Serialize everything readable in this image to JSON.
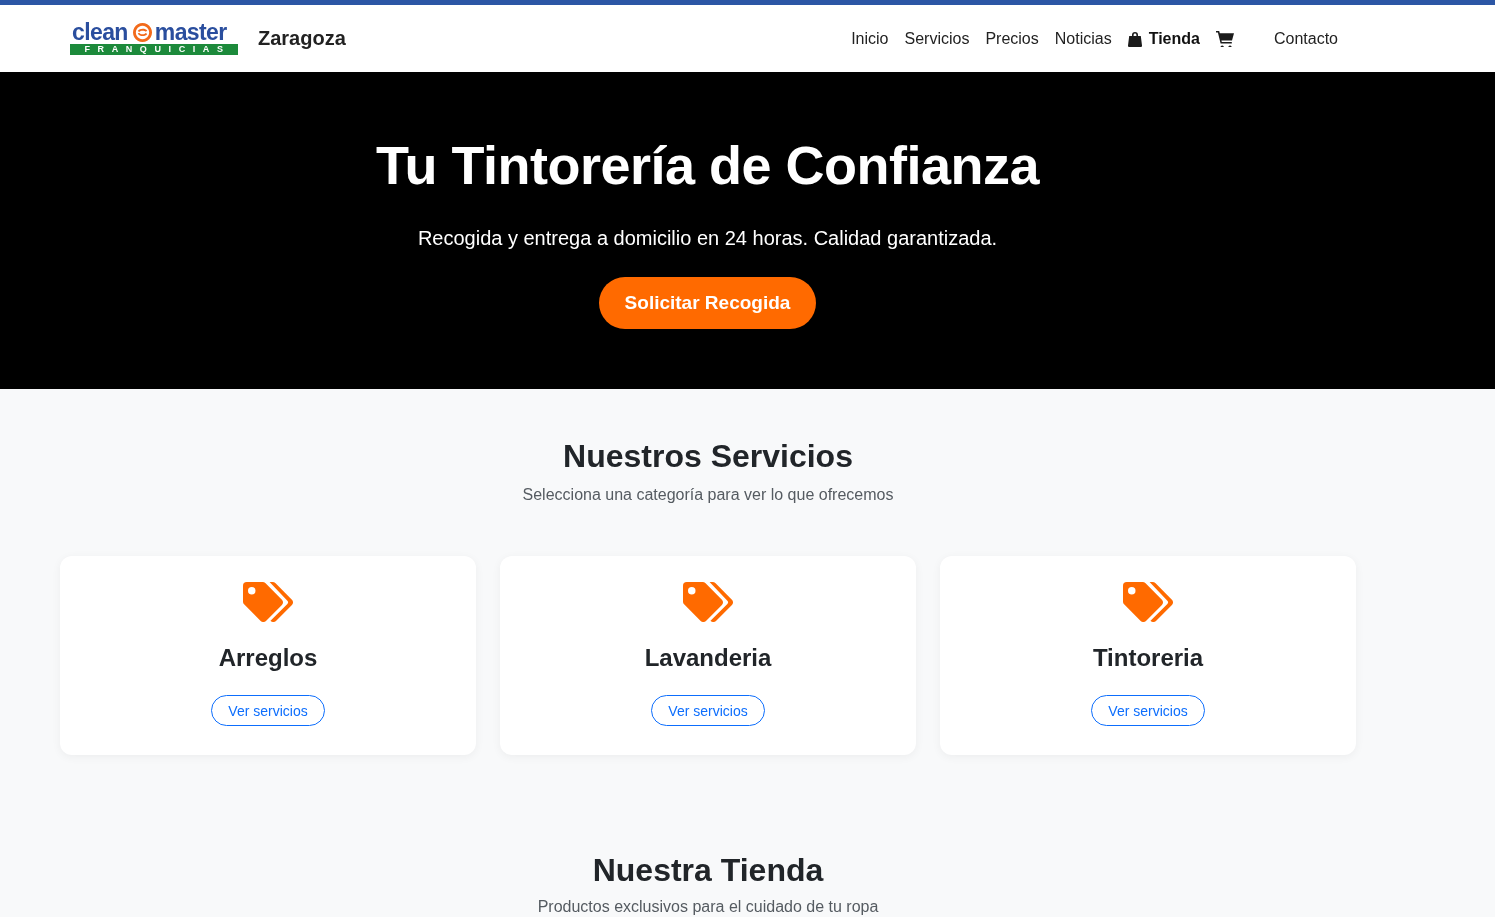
{
  "header": {
    "logo": {
      "word_1": "clean",
      "word_2": "master",
      "tagline": "FRANQUICIAS"
    },
    "city": "Zaragoza",
    "nav": [
      {
        "kind": "link",
        "label": "Inicio"
      },
      {
        "kind": "link",
        "label": "Servicios"
      },
      {
        "kind": "link",
        "label": "Precios"
      },
      {
        "kind": "link",
        "label": "Noticias"
      },
      {
        "kind": "shop",
        "label": "Tienda"
      },
      {
        "kind": "cart"
      },
      {
        "kind": "contact",
        "label": "Contacto"
      }
    ]
  },
  "hero": {
    "title": "Tu Tintorería de Confianza",
    "subtitle": "Recogida y entrega a domicilio en 24 horas. Calidad garantizada.",
    "button": "Solicitar Recogida"
  },
  "services": {
    "title": "Nuestros Servicios",
    "subtitle": "Selecciona una categoría para ver lo que ofrecemos",
    "cards": [
      {
        "title": "Arreglos",
        "button": "Ver servicios"
      },
      {
        "title": "Lavanderia",
        "button": "Ver servicios"
      },
      {
        "title": "Tintoreria",
        "button": "Ver servicios"
      }
    ]
  },
  "store": {
    "title": "Nuestra Tienda",
    "subtitle": "Productos exclusivos para el cuidado de tu ropa"
  }
}
